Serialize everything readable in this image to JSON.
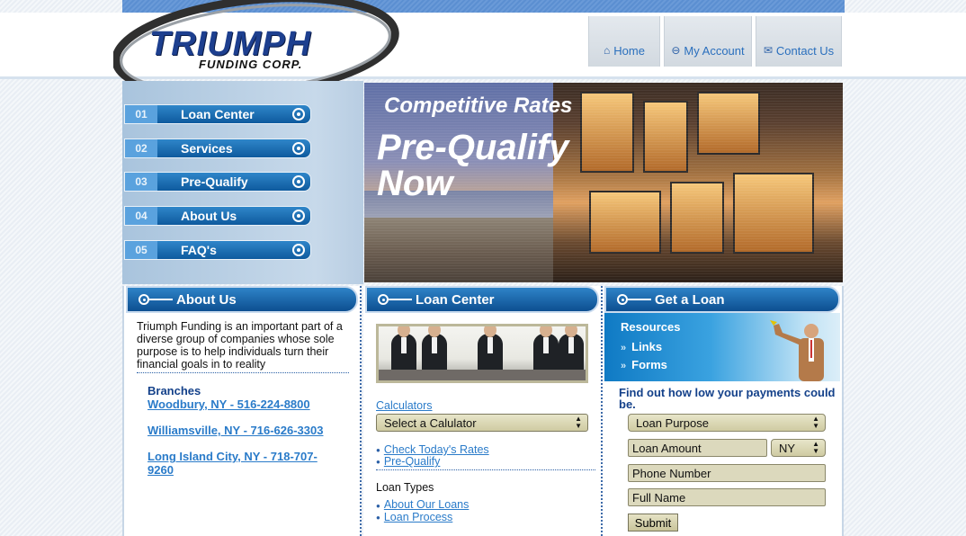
{
  "logo": {
    "main": "TRIUMPH",
    "sub": "FUNDING CORP."
  },
  "topnav": [
    {
      "label": "Home",
      "icon": "home-icon"
    },
    {
      "label": "My Account",
      "icon": "lock-icon"
    },
    {
      "label": "Contact Us",
      "icon": "mail-icon"
    }
  ],
  "leftnav": [
    {
      "num": "01",
      "label": "Loan Center"
    },
    {
      "num": "02",
      "label": "Services"
    },
    {
      "num": "03",
      "label": "Pre-Qualify"
    },
    {
      "num": "04",
      "label": "About Us"
    },
    {
      "num": "05",
      "label": "FAQ's"
    }
  ],
  "hero": {
    "line1": "Competitive Rates",
    "line2": "Pre-Qualify",
    "line3": "Now"
  },
  "about": {
    "heading": "About Us",
    "text": "Triumph Funding is an important part of a diverse group of companies whose sole purpose is to help individuals turn their financial goals in to reality",
    "branches_title": "Branches",
    "branches": [
      "Woodbury, NY - 516-224-8800",
      "Williamsville, NY - 716-626-3303",
      "Long Island City, NY - 718-707-9260"
    ]
  },
  "loan": {
    "heading": "Loan Center",
    "calculators_link": "Calculators",
    "calc_select": "Select a Calulator",
    "links1": [
      "Check Today's Rates",
      "Pre-Qualify"
    ],
    "loan_types_title": "Loan Types",
    "links2": [
      "About Our Loans",
      "Loan Process"
    ]
  },
  "get": {
    "heading": "Get a Loan",
    "resources_title": "Resources",
    "resources_links": [
      "Links",
      "Forms"
    ],
    "find": "Find out how low your payments could be.",
    "purpose": "Loan Purpose",
    "amount": "Loan Amount",
    "state": "NY",
    "phone": "Phone Number",
    "name": "Full Name",
    "submit": "Submit"
  }
}
